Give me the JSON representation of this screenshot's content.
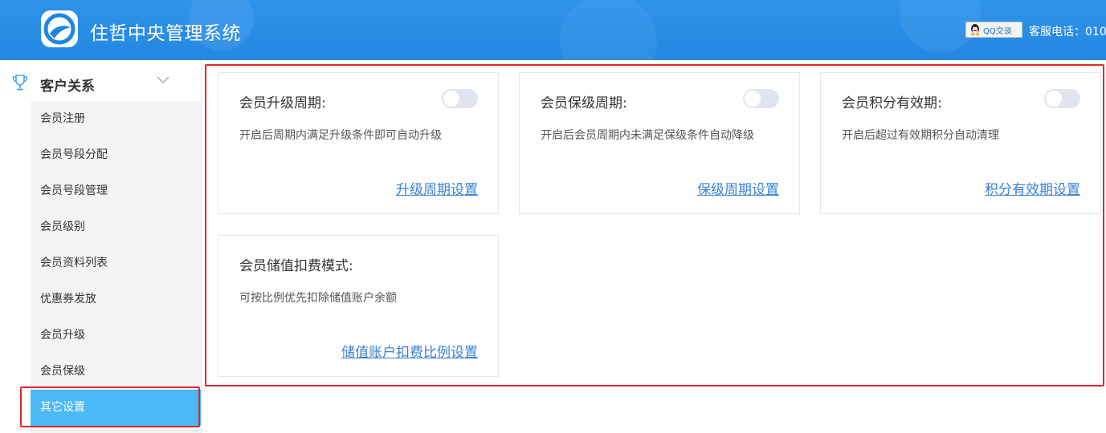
{
  "header": {
    "app_title": "住哲中央管理系统",
    "qq_label": "QQ交谈",
    "hotline": "客服电话：010"
  },
  "sidebar": {
    "section_title": "客户关系",
    "items": [
      {
        "label": "会员注册"
      },
      {
        "label": "会员号段分配"
      },
      {
        "label": "会员号段管理"
      },
      {
        "label": "会员级别"
      },
      {
        "label": "会员资料列表"
      },
      {
        "label": "优惠券发放"
      },
      {
        "label": "会员升级"
      },
      {
        "label": "会员保级"
      },
      {
        "label": "其它设置",
        "active": true
      }
    ]
  },
  "cards": [
    {
      "title": "会员升级周期:",
      "desc": "开启后周期内满足升级条件即可自动升级",
      "link": "升级周期设置",
      "toggle_on": false
    },
    {
      "title": "会员保级周期:",
      "desc": "开启后会员周期内未满足保级条件自动降级",
      "link": "保级周期设置",
      "toggle_on": false
    },
    {
      "title": "会员积分有效期:",
      "desc": "开启后超过有效期积分自动清理",
      "link": "积分有效期设置",
      "toggle_on": false
    },
    {
      "title": "会员储值扣费模式:",
      "desc": "可按比例优先扣除储值账户余额",
      "link": "储值账户扣费比例设置"
    }
  ],
  "colors": {
    "header_bg": "#2a8de6",
    "active_item_bg": "#4cb9f7",
    "highlight_border": "#e3262a",
    "link": "#3b80d6"
  }
}
